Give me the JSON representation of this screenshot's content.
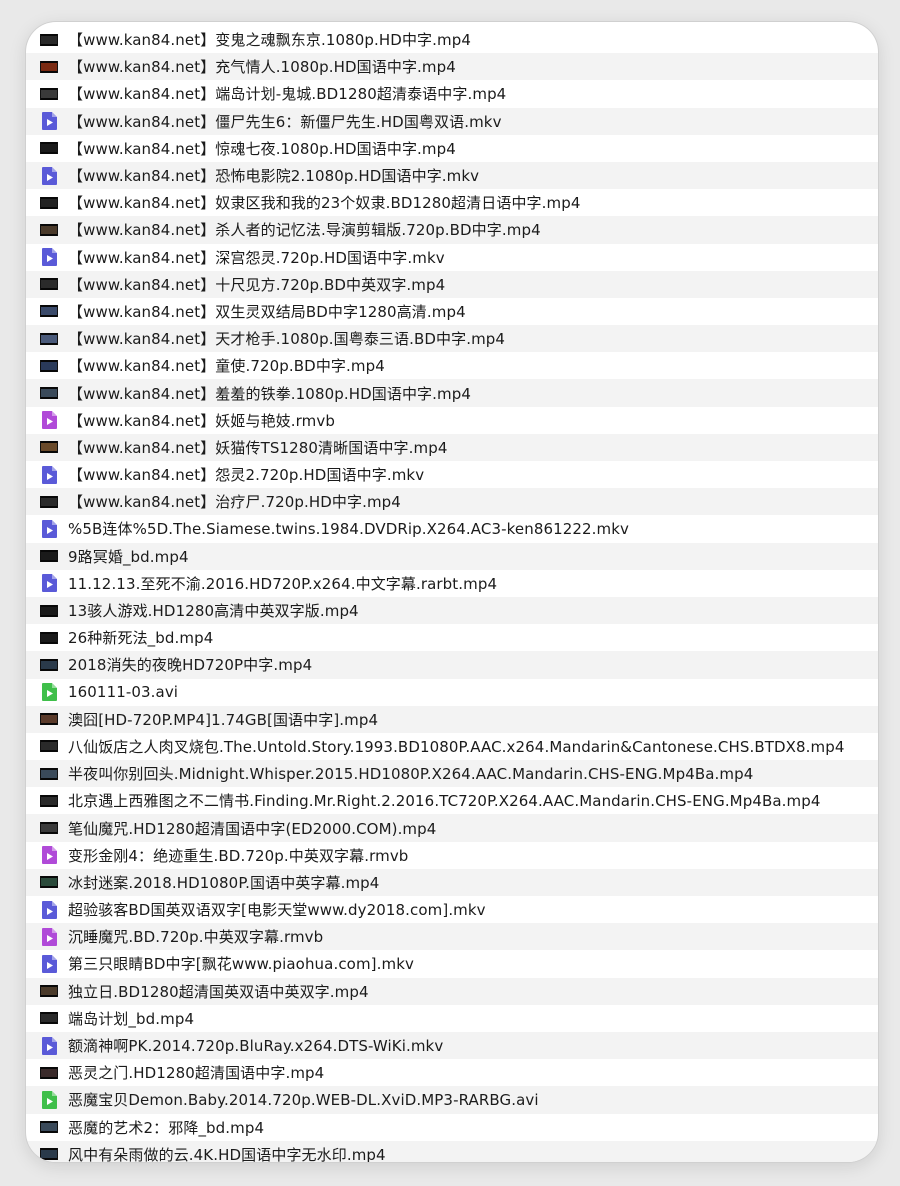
{
  "files": [
    {
      "name": "【www.kan84.net】变鬼之魂飘东京.1080p.HD中字.mp4",
      "icon": "video-thumbnail-icon",
      "color": "#2a2a2a"
    },
    {
      "name": "【www.kan84.net】充气情人.1080p.HD国语中字.mp4",
      "icon": "video-thumbnail-icon",
      "color": "#7a2a12"
    },
    {
      "name": "【www.kan84.net】端岛计划-鬼城.BD1280超清泰语中字.mp4",
      "icon": "video-thumbnail-icon",
      "color": "#3a3a3a"
    },
    {
      "name": "【www.kan84.net】僵尸先生6：新僵尸先生.HD国粤双语.mkv",
      "icon": "mkv-file-icon",
      "color": "#5a5ad8"
    },
    {
      "name": "【www.kan84.net】惊魂七夜.1080p.HD国语中字.mp4",
      "icon": "video-thumbnail-icon",
      "color": "#1a1a1a"
    },
    {
      "name": "【www.kan84.net】恐怖电影院2.1080p.HD国语中字.mkv",
      "icon": "mkv-file-icon",
      "color": "#5a5ad8"
    },
    {
      "name": "【www.kan84.net】奴隶区我和我的23个奴隶.BD1280超清日语中字.mp4",
      "icon": "video-thumbnail-icon",
      "color": "#222222"
    },
    {
      "name": "【www.kan84.net】杀人者的记忆法.导演剪辑版.720p.BD中字.mp4",
      "icon": "video-thumbnail-icon",
      "color": "#4a3a2a"
    },
    {
      "name": "【www.kan84.net】深宫怨灵.720p.HD国语中字.mkv",
      "icon": "mkv-file-icon",
      "color": "#5a5ad8"
    },
    {
      "name": "【www.kan84.net】十尺见方.720p.BD中英双字.mp4",
      "icon": "video-thumbnail-icon",
      "color": "#2b2b2b"
    },
    {
      "name": "【www.kan84.net】双生灵双结局BD中字1280高清.mp4",
      "icon": "video-thumbnail-icon",
      "color": "#3a4a6a"
    },
    {
      "name": "【www.kan84.net】天才枪手.1080p.国粤泰三语.BD中字.mp4",
      "icon": "video-thumbnail-icon",
      "color": "#4a5a7a"
    },
    {
      "name": "【www.kan84.net】童使.720p.BD中字.mp4",
      "icon": "video-thumbnail-icon",
      "color": "#2a3a5a"
    },
    {
      "name": "【www.kan84.net】羞羞的铁拳.1080p.HD国语中字.mp4",
      "icon": "video-thumbnail-icon",
      "color": "#3a4a5a"
    },
    {
      "name": "【www.kan84.net】妖姬与艳妓.rmvb",
      "icon": "rmvb-file-icon",
      "color": "#b04ad8"
    },
    {
      "name": "【www.kan84.net】妖猫传TS1280清晰国语中字.mp4",
      "icon": "video-thumbnail-icon",
      "color": "#6a4a2a"
    },
    {
      "name": "【www.kan84.net】怨灵2.720p.HD国语中字.mkv",
      "icon": "mkv-file-icon",
      "color": "#5a5ad8"
    },
    {
      "name": "【www.kan84.net】治疗尸.720p.HD中字.mp4",
      "icon": "video-thumbnail-icon",
      "color": "#2a2a2a"
    },
    {
      "name": "%5B连体%5D.The.Siamese.twins.1984.DVDRip.X264.AC3-ken861222.mkv",
      "icon": "mkv-file-icon",
      "color": "#5a5ad8"
    },
    {
      "name": "9路冥婚_bd.mp4",
      "icon": "video-thumbnail-icon",
      "color": "#1a1a1a"
    },
    {
      "name": "11.12.13.至死不渝.2016.HD720P.x264.中文字幕.rarbt.mp4",
      "icon": "mp4-file-icon",
      "color": "#5a5ad8"
    },
    {
      "name": "13骇人游戏.HD1280高清中英双字版.mp4",
      "icon": "video-thumbnail-icon",
      "color": "#1a1a1a"
    },
    {
      "name": "26种新死法_bd.mp4",
      "icon": "video-thumbnail-icon",
      "color": "#1a1a1a"
    },
    {
      "name": "2018消失的夜晚HD720P中字.mp4",
      "icon": "video-thumbnail-icon",
      "color": "#2a3a4a"
    },
    {
      "name": "160111-03.avi",
      "icon": "avi-file-icon",
      "color": "#3fbf4a"
    },
    {
      "name": "澳囧[HD-720P.MP4]1.74GB[国语中字].mp4",
      "icon": "video-thumbnail-icon",
      "color": "#5a3a2a"
    },
    {
      "name": "八仙饭店之人肉叉烧包.The.Untold.Story.1993.BD1080P.AAC.x264.Mandarin&Cantonese.CHS.BTDX8.mp4",
      "icon": "video-thumbnail-icon",
      "color": "#2a2a2a"
    },
    {
      "name": "半夜叫你别回头.Midnight.Whisper.2015.HD1080P.X264.AAC.Mandarin.CHS-ENG.Mp4Ba.mp4",
      "icon": "video-thumbnail-icon",
      "color": "#3a4a5a"
    },
    {
      "name": "北京遇上西雅图之不二情书.Finding.Mr.Right.2.2016.TC720P.X264.AAC.Mandarin.CHS-ENG.Mp4Ba.mp4",
      "icon": "video-thumbnail-icon",
      "color": "#2a2a2a"
    },
    {
      "name": "笔仙魔咒.HD1280超清国语中字(ED2000.COM).mp4",
      "icon": "video-thumbnail-icon",
      "color": "#3a3a3a"
    },
    {
      "name": "变形金刚4：绝迹重生.BD.720p.中英双字幕.rmvb",
      "icon": "rmvb-file-icon",
      "color": "#b04ad8"
    },
    {
      "name": "冰封迷案.2018.HD1080P.国语中英字幕.mp4",
      "icon": "video-thumbnail-icon",
      "color": "#2a4a3a"
    },
    {
      "name": "超验骇客BD国英双语双字[电影天堂www.dy2018.com].mkv",
      "icon": "mkv-file-icon",
      "color": "#5a5ad8"
    },
    {
      "name": "沉睡魔咒.BD.720p.中英双字幕.rmvb",
      "icon": "rmvb-file-icon",
      "color": "#b04ad8"
    },
    {
      "name": "第三只眼睛BD中字[飘花www.piaohua.com].mkv",
      "icon": "mkv-file-icon",
      "color": "#5a5ad8"
    },
    {
      "name": "独立日.BD1280超清国英双语中英双字.mp4",
      "icon": "video-thumbnail-icon",
      "color": "#4a3a2a"
    },
    {
      "name": "端岛计划_bd.mp4",
      "icon": "video-thumbnail-icon",
      "color": "#2a2a2a"
    },
    {
      "name": "额滴神啊PK.2014.720p.BluRay.x264.DTS-WiKi.mkv",
      "icon": "mkv-file-icon",
      "color": "#5a5ad8"
    },
    {
      "name": "恶灵之门.HD1280超清国语中字.mp4",
      "icon": "video-thumbnail-icon",
      "color": "#3a2a2a"
    },
    {
      "name": "恶魔宝贝Demon.Baby.2014.720p.WEB-DL.XviD.MP3-RARBG.avi",
      "icon": "avi-file-icon",
      "color": "#3fbf4a"
    },
    {
      "name": "恶魔的艺术2：邪降_bd.mp4",
      "icon": "video-thumbnail-icon",
      "color": "#3a4a5a"
    },
    {
      "name": "风中有朵雨做的云.4K.HD国语中字无水印.mp4",
      "icon": "video-thumbnail-icon",
      "color": "#2a3a4a"
    }
  ]
}
